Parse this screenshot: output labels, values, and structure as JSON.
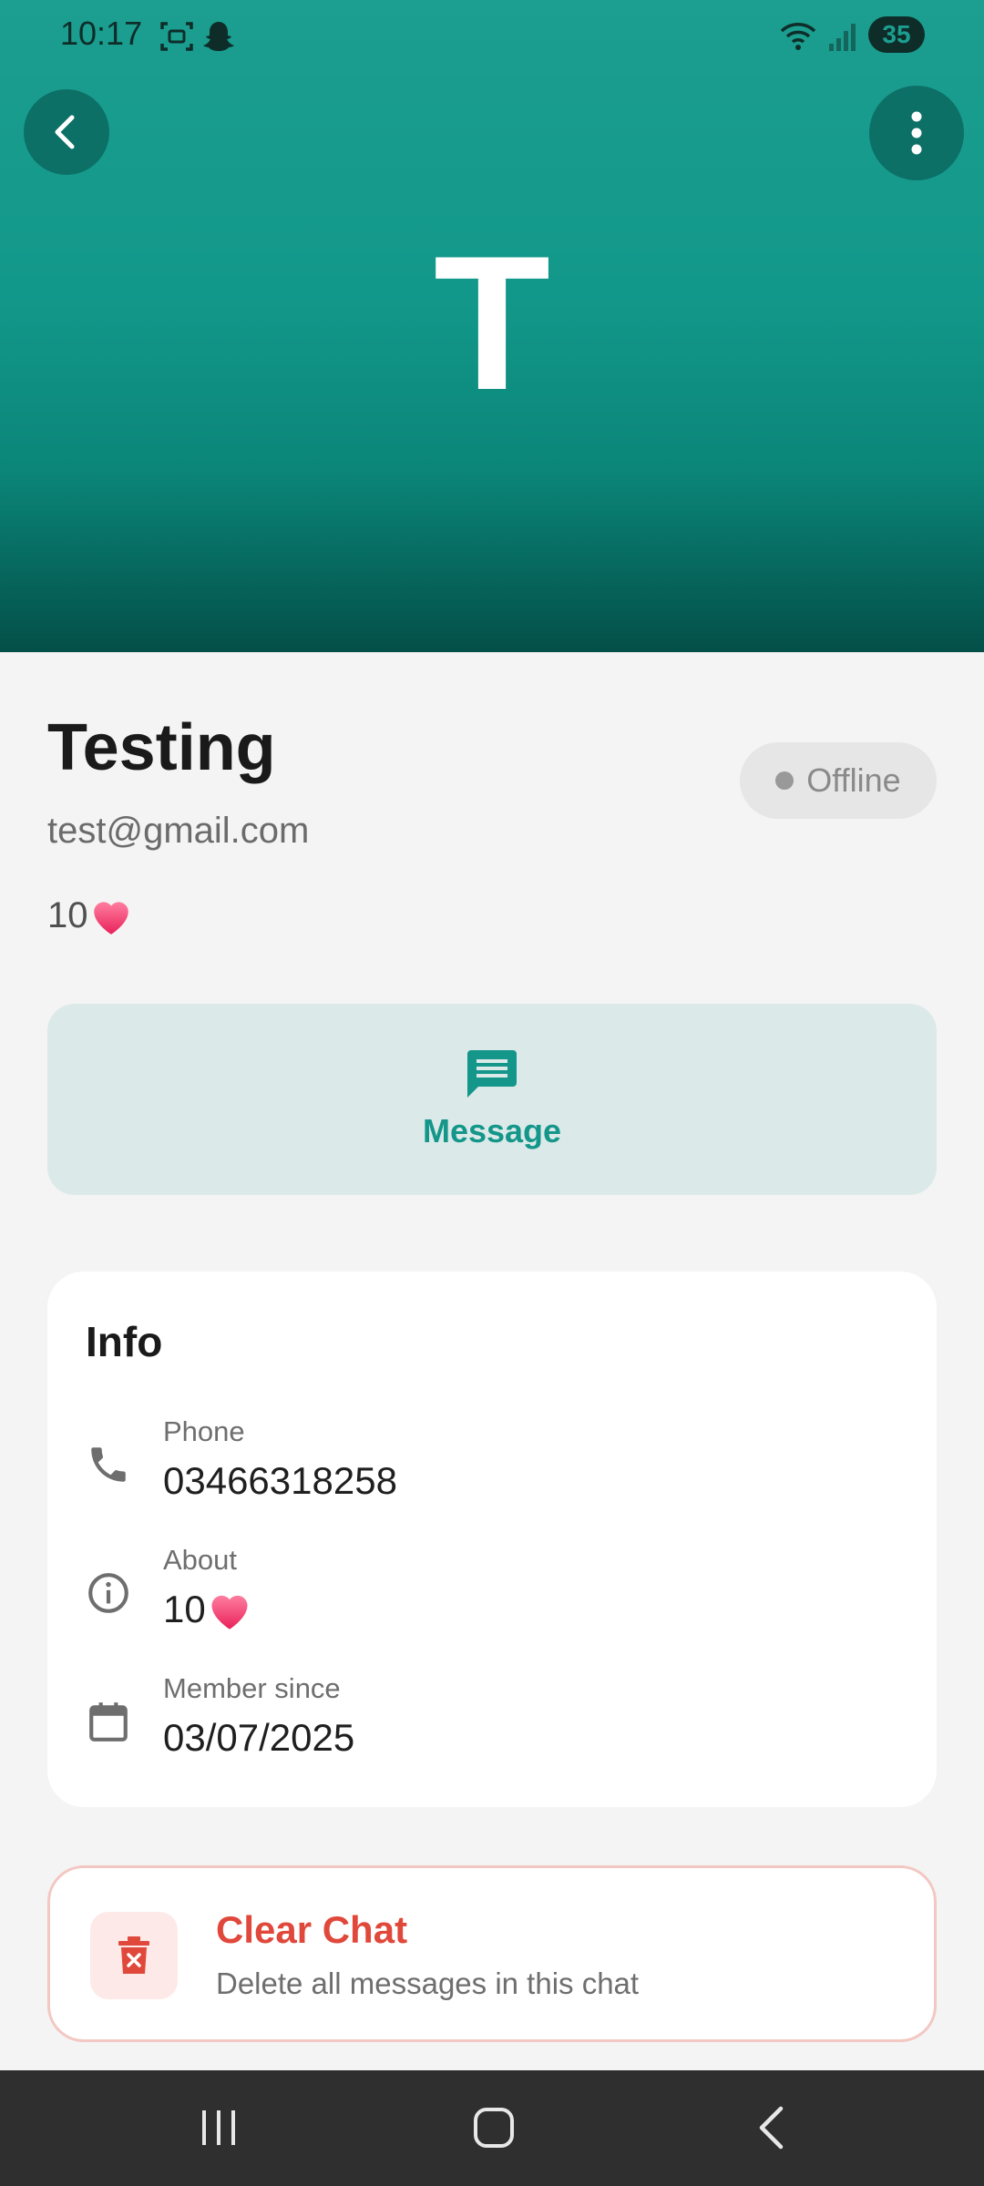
{
  "status_bar": {
    "time": "10:17",
    "battery": "35",
    "icons": [
      "screenshot-icon",
      "snapchat-icon",
      "wifi-icon",
      "signal-icon"
    ]
  },
  "header": {
    "initial": "T",
    "back_icon": "chevron-left-icon",
    "more_icon": "more-vertical-icon",
    "colors": {
      "top": "#1c9e90",
      "bottom": "#034f48"
    }
  },
  "profile": {
    "name": "Testing",
    "email": "test@gmail.com",
    "bio": "10",
    "bio_emoji": "heart-icon",
    "status": "Offline"
  },
  "message_button": {
    "label": "Message",
    "icon": "chat-bubble-icon",
    "accent": "#14968a"
  },
  "info": {
    "title": "Info",
    "rows": [
      {
        "label": "Phone",
        "value": "03466318258",
        "icon": "phone-icon"
      },
      {
        "label": "About",
        "value": "10",
        "icon": "info-icon",
        "emoji": "heart-icon"
      },
      {
        "label": "Member since",
        "value": "03/07/2025",
        "icon": "calendar-icon"
      }
    ]
  },
  "clear_chat": {
    "title": "Clear Chat",
    "subtitle": "Delete all messages in this chat",
    "icon": "trash-icon",
    "accent": "#e0483b"
  },
  "nav": {
    "items": [
      "recents-icon",
      "home-icon",
      "back-icon"
    ]
  }
}
